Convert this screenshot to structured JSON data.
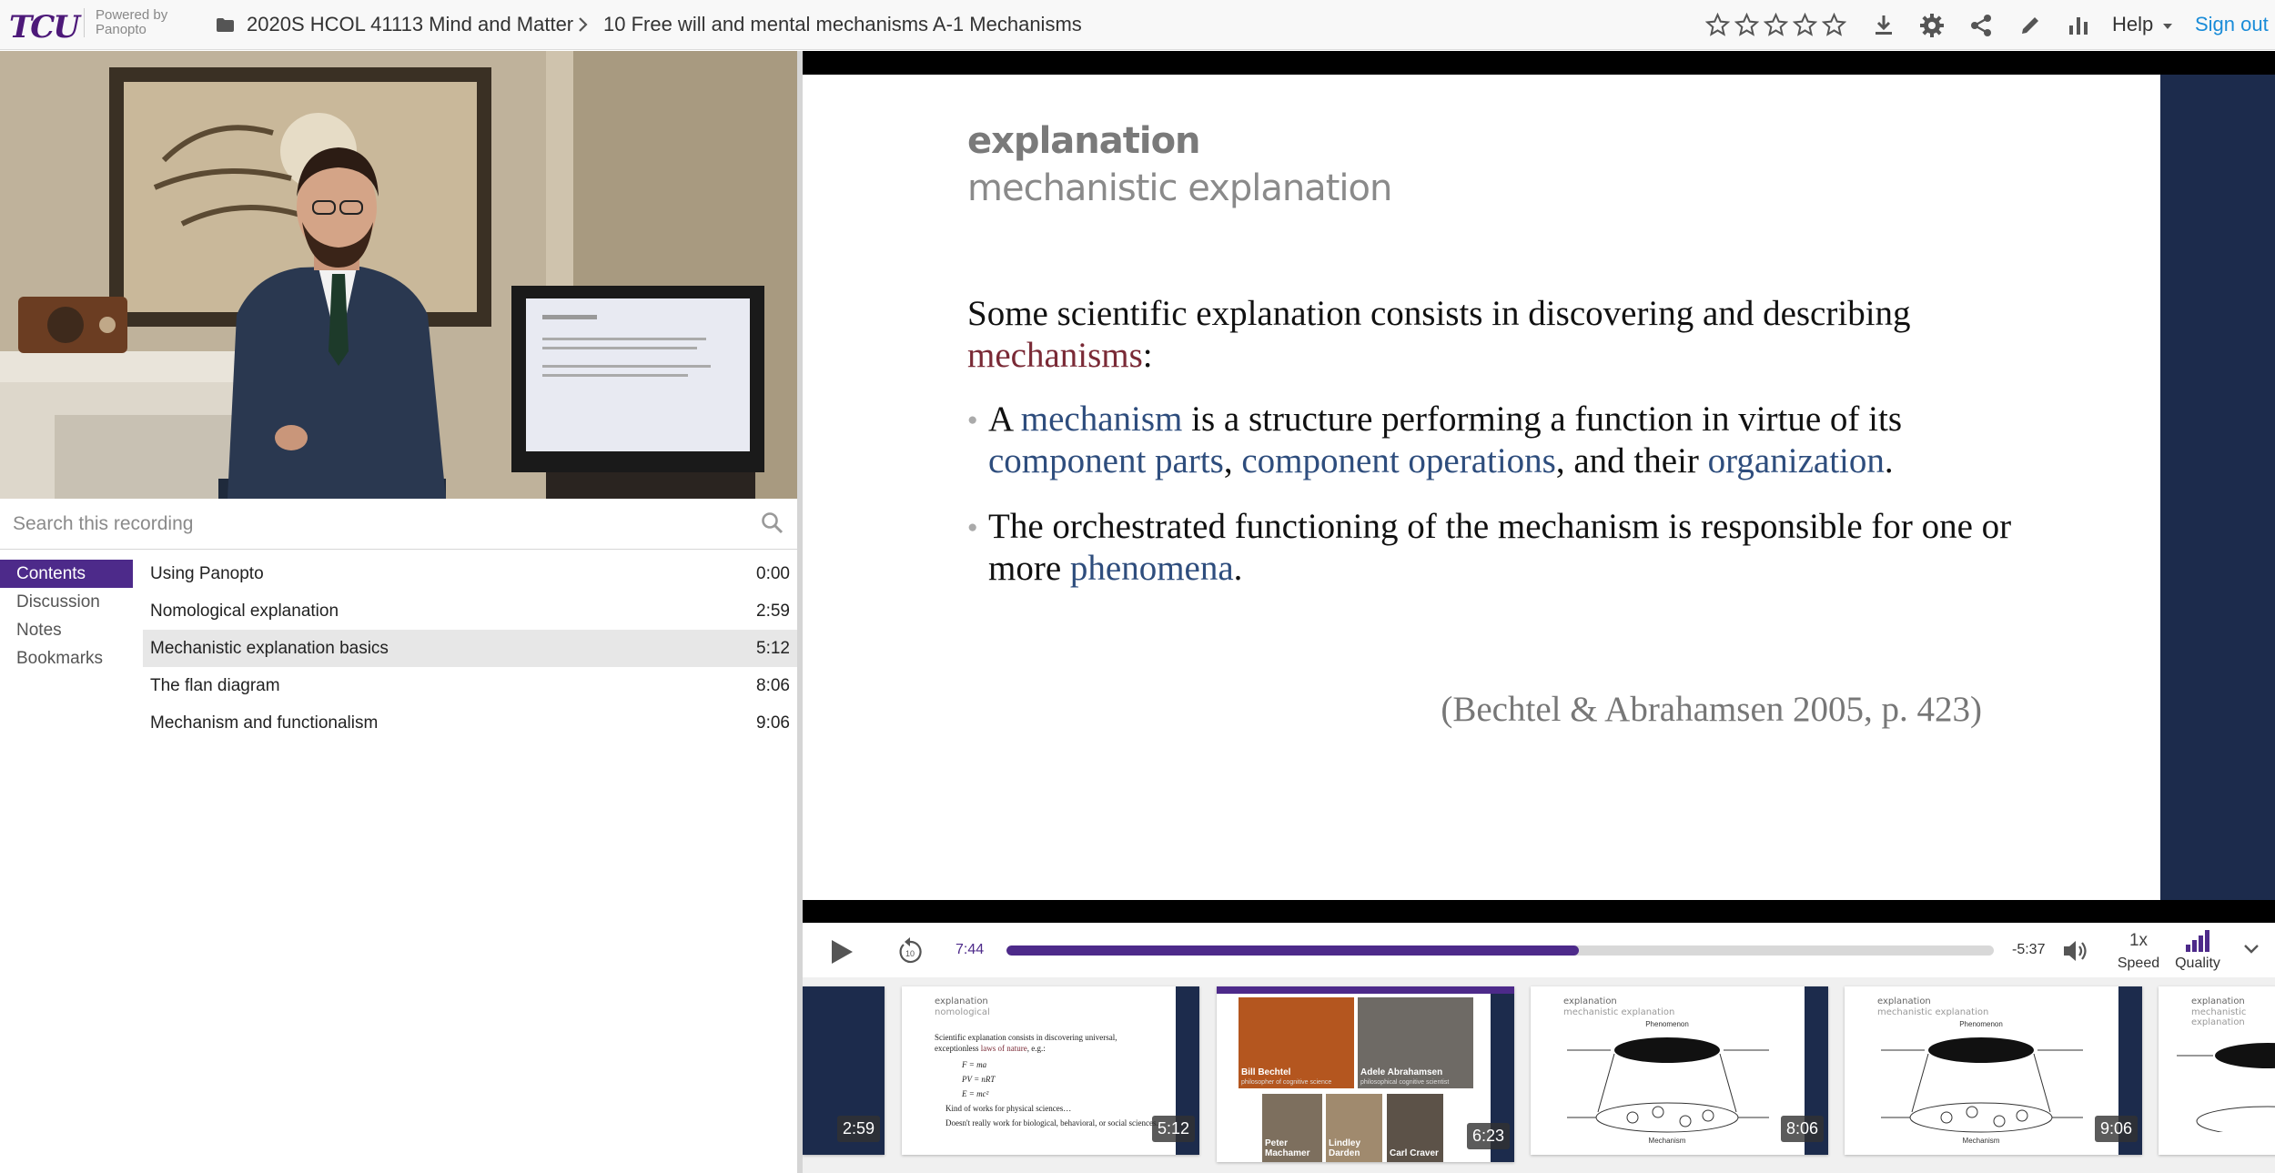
{
  "header": {
    "logo_text": "TCU",
    "powered_by": "Powered by",
    "powered_brand": "Panopto",
    "breadcrumb_folder": "2020S HCOL 41113 Mind and Matter",
    "breadcrumb_session": "10 Free will and mental mechanisms A-1 Mechanisms",
    "help_label": "Help",
    "sign_out_label": "Sign out",
    "rating_stars": 5
  },
  "search": {
    "placeholder": "Search this recording"
  },
  "tabs": [
    {
      "label": "Contents",
      "active": true
    },
    {
      "label": "Discussion",
      "active": false
    },
    {
      "label": "Notes",
      "active": false
    },
    {
      "label": "Bookmarks",
      "active": false
    }
  ],
  "contents": [
    {
      "title": "Using Panopto",
      "time": "0:00"
    },
    {
      "title": "Nomological explanation",
      "time": "2:59"
    },
    {
      "title": "Mechanistic explanation basics",
      "time": "5:12",
      "active": true
    },
    {
      "title": "The flan diagram",
      "time": "8:06"
    },
    {
      "title": "Mechanism and functionalism",
      "time": "9:06"
    }
  ],
  "slide": {
    "title": "explanation",
    "subtitle": "mechanistic explanation",
    "intro_a": "Some scientific explanation consists in discovering and describing",
    "intro_kw": "mechanisms",
    "intro_b": ":",
    "b1_a": "A",
    "b1_kw1": "mechanism",
    "b1_b": "is a structure performing a function in virtue of its",
    "b1_kw2": "component parts",
    "b1_c": ",",
    "b1_kw3": "component operations",
    "b1_d": ", and their",
    "b1_kw4": "organization",
    "b1_e": ".",
    "b2_a": "The orchestrated functioning of the mechanism is responsible for one or more",
    "b2_kw": "phenomena",
    "b2_b": ".",
    "citation": "(Bechtel & Abrahamsen 2005, p. 423)"
  },
  "player": {
    "current_time": "7:44",
    "remaining_time": "-5:37",
    "progress": 0.58,
    "rewind_seconds": "10",
    "speed_value": "1x",
    "speed_label": "Speed",
    "quality_label": "Quality"
  },
  "thumbnails": [
    {
      "time": "2:59"
    },
    {
      "time": "5:12",
      "title": "explanation",
      "subtitle": "nomological",
      "line1": "Scientific explanation consists in discovering universal, exceptionless",
      "line1_kw": "laws of nature",
      "line1_end": ", e.g.:",
      "eq1": "F = ma",
      "eq2": "PV = nRT",
      "eq3": "E = mc²",
      "line2": "Kind of works for physical sciences…",
      "line3": "Doesn't really work for biological, behavioral, or social sciences."
    },
    {
      "time": "6:23",
      "p1_name": "Bill Bechtel",
      "p1_role": "philosopher of cognitive science",
      "p2_name": "Adele Abrahamsen",
      "p2_role": "philosophical cognitive scientist",
      "p3_name": "Peter Machamer",
      "p4_name": "Lindley Darden",
      "p5_name": "Carl Craver"
    },
    {
      "time": "8:06",
      "title": "explanation",
      "subtitle": "mechanistic explanation",
      "top_label": "Phenomenon",
      "bottom_label": "Mechanism"
    },
    {
      "time": "9:06",
      "title": "explanation",
      "subtitle": "mechanistic explanation",
      "top_label": "Phenomenon",
      "bottom_label": "Mechanism"
    },
    {
      "title": "explanation",
      "subtitle": "mechanistic explanation"
    }
  ],
  "colors": {
    "brand_purple": "#4d2a8a",
    "slide_navy": "#1c2b4c",
    "keyword_red": "#7a2a36",
    "keyword_blue": "#2e4d7d",
    "link_blue": "#1a8cd8"
  }
}
